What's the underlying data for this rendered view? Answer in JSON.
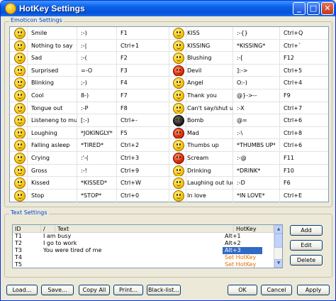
{
  "window": {
    "title": "HotKey Settings",
    "controls": {
      "minimize": "_",
      "maximize": "□",
      "close": "✕"
    }
  },
  "emoticon_settings": {
    "label": "Emoticon Settings",
    "left": [
      {
        "name": "Smile",
        "code": ":-)",
        "hotkey": "F1",
        "icon": "smile-icon"
      },
      {
        "name": "Nothing to say",
        "code": ":-|",
        "hotkey": "Ctrl+1",
        "icon": "neutral-icon"
      },
      {
        "name": "Sad",
        "code": ":-(",
        "hotkey": "F2",
        "icon": "sad-icon"
      },
      {
        "name": "Surprised",
        "code": "=-O",
        "hotkey": "F3",
        "icon": "surprised-icon"
      },
      {
        "name": "Blinking",
        "code": ";-)",
        "hotkey": "F4",
        "icon": "wink-icon"
      },
      {
        "name": "Cool",
        "code": "8-)",
        "hotkey": "F7",
        "icon": "cool-icon"
      },
      {
        "name": "Tongue out",
        "code": ":-P",
        "hotkey": "F8",
        "icon": "tongue-icon"
      },
      {
        "name": "Listeneng to musik",
        "code": "[:-)",
        "hotkey": "Ctrl+-",
        "icon": "music-icon"
      },
      {
        "name": "Loughing",
        "code": "*JOKINGLY*",
        "hotkey": "F5",
        "icon": "laughing-icon"
      },
      {
        "name": "Falling asleep",
        "code": "*TIRED*",
        "hotkey": "Ctrl+2",
        "icon": "sleepy-icon"
      },
      {
        "name": "Crying",
        "code": ":'-(",
        "hotkey": "Ctrl+3",
        "icon": "crying-icon"
      },
      {
        "name": "Gross",
        "code": ":-!",
        "hotkey": "Ctrl+9",
        "icon": "gross-icon"
      },
      {
        "name": "Kissed",
        "code": "*KISSED*",
        "hotkey": "Ctrl+W",
        "icon": "kissed-icon"
      },
      {
        "name": "Stop",
        "code": "*STOP*",
        "hotkey": "Ctrl+0",
        "icon": "stop-icon"
      }
    ],
    "right": [
      {
        "name": "KISS",
        "code": ":-{}",
        "hotkey": "Ctrl+Q",
        "icon": "kiss-icon"
      },
      {
        "name": "KISSING",
        "code": "*KISSING*",
        "hotkey": "Ctrl+`",
        "icon": "kissing-icon"
      },
      {
        "name": "Blushing",
        "code": ":-[",
        "hotkey": "F12",
        "icon": "blushing-icon"
      },
      {
        "name": "Devil",
        "code": "]:->",
        "hotkey": "Ctrl+5",
        "icon": "devil-icon"
      },
      {
        "name": "Angel",
        "code": "O:-)",
        "hotkey": "Ctrl+4",
        "icon": "angel-icon"
      },
      {
        "name": "Thank you",
        "code": "@}->--",
        "hotkey": "F9",
        "icon": "rose-icon"
      },
      {
        "name": "Can't say/shut up",
        "code": ":-X",
        "hotkey": "Ctrl+7",
        "icon": "shut-up-icon"
      },
      {
        "name": "Bomb",
        "code": "@=",
        "hotkey": "Ctrl+6",
        "icon": "bomb-icon"
      },
      {
        "name": "Mad",
        "code": ":-\\",
        "hotkey": "Ctrl+8",
        "icon": "mad-icon"
      },
      {
        "name": "Thumbs up",
        "code": "*THUMBS UP*",
        "hotkey": "Ctrl+6",
        "icon": "thumbs-up-icon"
      },
      {
        "name": "Scream",
        "code": ":-@",
        "hotkey": "F11",
        "icon": "scream-icon"
      },
      {
        "name": "Drinking",
        "code": "*DRINK*",
        "hotkey": "F10",
        "icon": "drinking-icon"
      },
      {
        "name": "Laughing out luod",
        "code": ":-D",
        "hotkey": "F6",
        "icon": "lol-icon"
      },
      {
        "name": "In love",
        "code": "*IN LOVE*",
        "hotkey": "Ctrl+E",
        "icon": "in-love-icon"
      }
    ]
  },
  "text_settings": {
    "label": "Text Settings",
    "columns": {
      "id": "ID",
      "sort": "/",
      "text": "Text",
      "hotkey": "HotKey"
    },
    "rows": [
      {
        "id": "T1",
        "text": "I am busy",
        "hotkey": "Alt+1",
        "state": "normal"
      },
      {
        "id": "T2",
        "text": "I go to work",
        "hotkey": "Alt+2",
        "state": "normal"
      },
      {
        "id": "T3",
        "text": "You were tired of me",
        "hotkey": "Alt+3",
        "state": "selected"
      },
      {
        "id": "T4",
        "text": "",
        "hotkey": "Set HotKey",
        "state": "unset"
      },
      {
        "id": "T5",
        "text": "",
        "hotkey": "Set HotKey",
        "state": "unset"
      }
    ],
    "buttons": {
      "add": "Add",
      "edit": "Edit",
      "delete": "Delete"
    }
  },
  "footer": {
    "load": "Load...",
    "save": "Save...",
    "copy_all": "Copy All",
    "print": "Print...",
    "blacklist": "Black-list...",
    "ok": "OK",
    "cancel": "Cancel",
    "apply": "Apply"
  },
  "colors": {
    "title_bar": "#0553d8",
    "group_label": "#0046d5",
    "selection": "#316ac5",
    "set_hotkey": "#e07000"
  }
}
